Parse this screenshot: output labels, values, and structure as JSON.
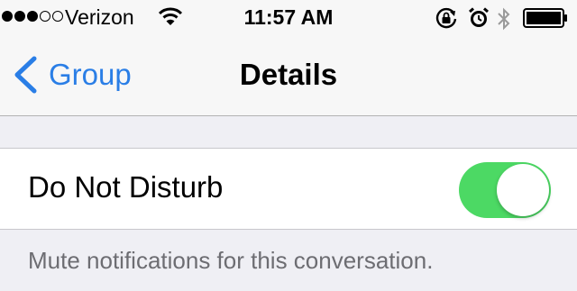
{
  "status_bar": {
    "signal_bars_total": 5,
    "signal_bars_filled": 3,
    "carrier": "Verizon",
    "time": "11:57 AM",
    "icons": [
      "wifi-icon",
      "rotation-lock-icon",
      "alarm-icon",
      "bluetooth-icon",
      "battery-icon"
    ],
    "battery_level": 1.0
  },
  "nav": {
    "back_label": "Group",
    "title": "Details",
    "accent_color": "#2a7ee6"
  },
  "settings": {
    "do_not_disturb": {
      "label": "Do Not Disturb",
      "enabled": true,
      "on_color": "#4cd964"
    },
    "footer": "Mute notifications for this conversation."
  }
}
